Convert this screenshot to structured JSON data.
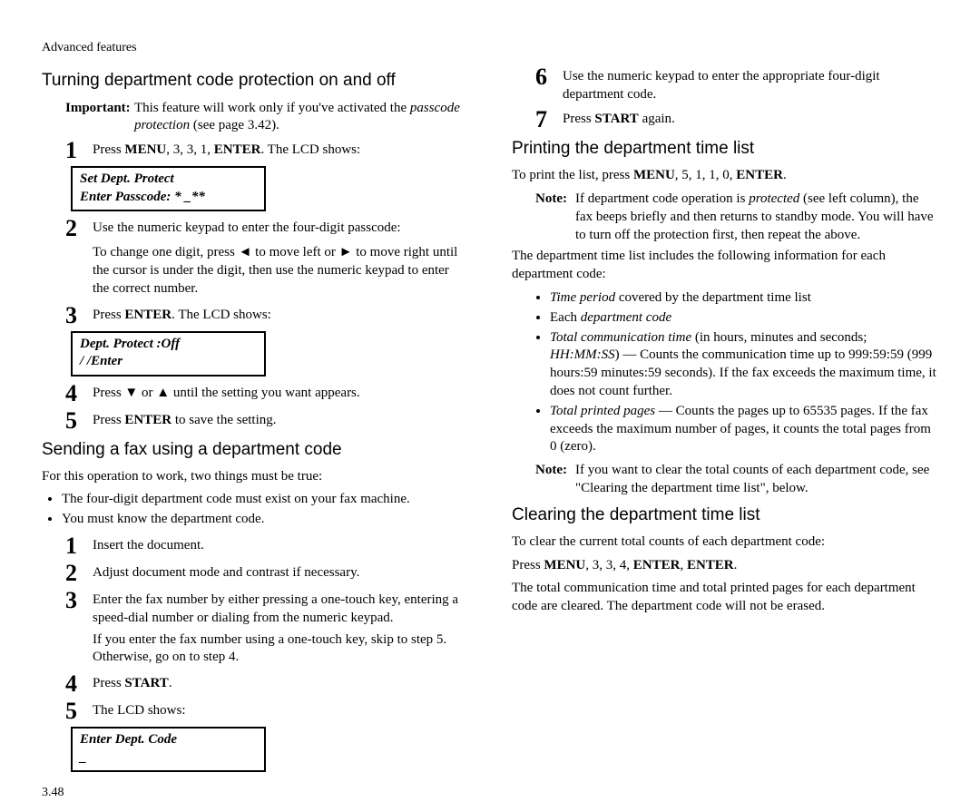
{
  "runHead": "Advanced features",
  "pageNum": "3.48",
  "left": {
    "h1": "Turning department code protection on and off",
    "importantLabel": "Important:",
    "importantA": "This feature will work only if you've activated the ",
    "importantEm": "passcode protection",
    "importantB": " (see page 3.42).",
    "s1a": "Press ",
    "s1b": "MENU",
    "s1c": ", 3, 3, 1, ",
    "s1d": "ENTER",
    "s1e": ". The ",
    "s1f": "LCD",
    "s1g": " shows:",
    "lcd1a": "Set Dept. Protect",
    "lcd1b": "Enter Passcode: *   _**",
    "s2": "Use the numeric keypad to enter the four-digit passcode:",
    "s2sub": "To change one digit, press ◄ to move left or ► to move right until the cursor is under the digit, then use the numeric keypad to enter the correct number.",
    "s3a": "Press ",
    "s3b": "ENTER",
    "s3c": ". The ",
    "s3d": "LCD",
    "s3e": " shows:",
    "lcd2a": "Dept. Protect   :Off",
    "lcd2b": "                    /    /Enter",
    "s4": "Press ▼ or ▲ until the setting you want appears.",
    "s5a": "Press ",
    "s5b": "ENTER",
    "s5c": " to save the setting.",
    "h2": "Sending a fax using a department code",
    "p1": "For this operation to work, two things must be true:",
    "b1": "The four-digit department code must exist on your fax machine.",
    "b2": "You must know the department code.",
    "ss1": "Insert the document.",
    "ss2": "Adjust document mode and contrast if necessary.",
    "ss3": "Enter the fax number by either pressing a one-touch key, entering a speed-dial number or dialing from the numeric keypad.",
    "ss3sub": "If you enter the fax number using a one-touch key, skip to step 5. Otherwise, go on to step 4.",
    "ss4a": "Press ",
    "ss4b": "START",
    "ss4c": ".",
    "ss5a": "The ",
    "ss5b": "LCD",
    "ss5c": " shows:",
    "lcd3a": "Enter Dept.  Code",
    "lcd3b": "_"
  },
  "right": {
    "s6": "Use the numeric keypad to enter the appropriate four-digit department code.",
    "s7a": "Press ",
    "s7b": "START",
    "s7c": " again.",
    "h1": "Printing the department time list",
    "p1a": "To print the list, press ",
    "p1b": "MENU",
    "p1c": ", 5, 1, 1, 0, ",
    "p1d": "ENTER",
    "p1e": ".",
    "noteLabel": "Note:",
    "n1a": "If department code operation is ",
    "n1em": "protected",
    "n1b": " (see left column), the fax beeps briefly and then returns to standby mode. You will have to turn off the protection first, then repeat the above.",
    "p2": "The department time list includes the following information for each department code:",
    "li1a": "Time period",
    "li1b": " covered by the department time list",
    "li2a": "Each ",
    "li2b": "department code",
    "li3a": "Total communication time",
    "li3b": " (in hours, minutes and seconds; ",
    "li3c": "HH:MM:SS",
    "li3d": ") — Counts the communication time up to 999:59:59 (999 hours:59 minutes:59 seconds). If the fax exceeds the maximum time, it does not count further.",
    "li4a": "Total printed pages",
    "li4b": " — Counts the pages up to 65535 pages. If the fax exceeds the maximum number of pages, it counts the total pages from 0 (zero).",
    "n2": "If you want to clear the total counts of each department code, see \"Clearing the department time list\", below.",
    "h2": "Clearing the department time list",
    "p3": "To clear the current total counts of each department code:",
    "p4a": "Press ",
    "p4b": "MENU",
    "p4c": ", 3, 3, 4, ",
    "p4d": "ENTER",
    "p4e": ", ",
    "p4f": "ENTER",
    "p4g": ".",
    "p5": "The total communication time and total printed pages for each department code are cleared. The department code will not be erased."
  }
}
